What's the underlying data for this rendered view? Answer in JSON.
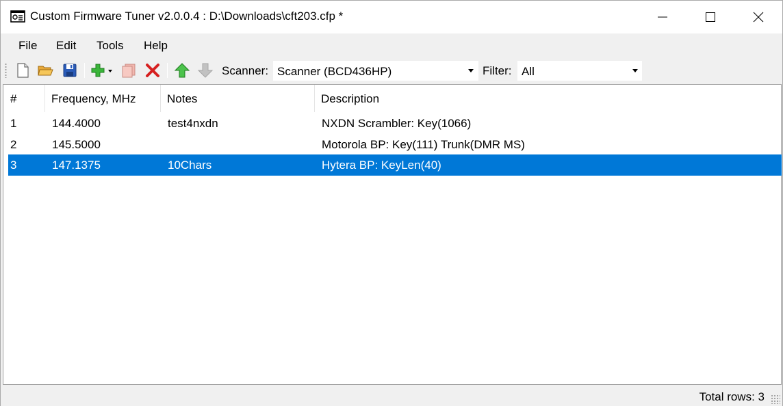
{
  "window": {
    "title": "Custom Firmware Tuner v2.0.0.4 : D:\\Downloads\\cft203.cfp *"
  },
  "menu": {
    "items": [
      {
        "label": "File"
      },
      {
        "label": "Edit"
      },
      {
        "label": "Tools"
      },
      {
        "label": "Help"
      }
    ]
  },
  "toolbar": {
    "icons": [
      "new-file-icon",
      "open-folder-icon",
      "save-icon",
      "add-icon",
      "copy-icon",
      "delete-icon",
      "move-up-icon",
      "move-down-icon"
    ],
    "scanner_label": "Scanner:",
    "scanner_value": "Scanner (BCD436HP)",
    "filter_label": "Filter:",
    "filter_value": "All"
  },
  "table": {
    "columns": [
      "#",
      "Frequency, MHz",
      "Notes",
      "Description"
    ],
    "rows": [
      {
        "num": "1",
        "frequency": "144.4000",
        "notes": "test4nxdn",
        "description": "NXDN Scrambler: Key(1066)",
        "selected": false
      },
      {
        "num": "2",
        "frequency": "145.5000",
        "notes": "",
        "description": "Motorola BP: Key(111) Trunk(DMR MS)",
        "selected": false
      },
      {
        "num": "3",
        "frequency": "147.1375",
        "notes": "10Chars",
        "description": "Hytera BP: KeyLen(40)",
        "selected": true
      }
    ]
  },
  "status": {
    "total_rows": "Total rows: 3"
  },
  "colors": {
    "selection": "#0078d7",
    "chrome": "#f0f0f0"
  }
}
